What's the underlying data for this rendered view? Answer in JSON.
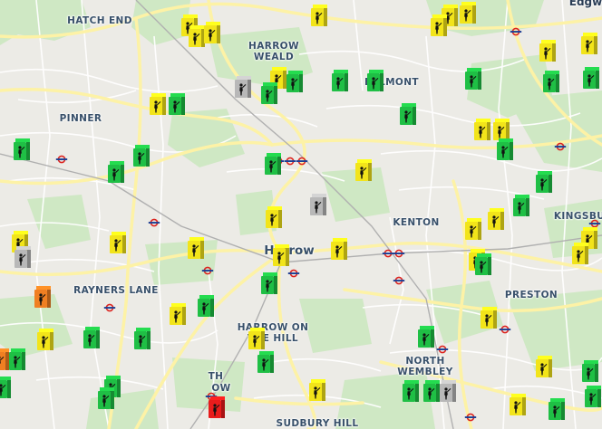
{
  "places": {
    "hatch_end": "HATCH END",
    "harrow_weald": "HARROW\nWEALD",
    "belmont": "BELMONT",
    "pinner": "PINNER",
    "kenton": "KENTON",
    "kingsbury": "KINGSBU",
    "harrow": "Harrow",
    "rayners_lane": "RAYNERS LANE",
    "preston": "PRESTON",
    "harrow_on_the_hill": "HARROW ON\nTHE HILL",
    "north_wembley": "NORTH\nWEMBLEY",
    "sudbury_hill": "SUDBURY HILL",
    "edgware": "Edgw",
    "partial_th": "TH",
    "partial_ow": "OW"
  },
  "marker_colors": {
    "green": "#1fbf45",
    "yellow": "#f2e41a",
    "grey": "#b8b8b8",
    "orange": "#f07f22",
    "red": "#e81c1c"
  },
  "marker_icon": "toilet-figure-icon",
  "station_icon": "underground-roundel-icon",
  "map_colors": {
    "background": "#ecebe6",
    "road_major": "#fdf2a6",
    "road_minor": "#ffffff",
    "park": "#cfe8c4",
    "railway": "#b0b0b0",
    "label": "#38506a"
  }
}
